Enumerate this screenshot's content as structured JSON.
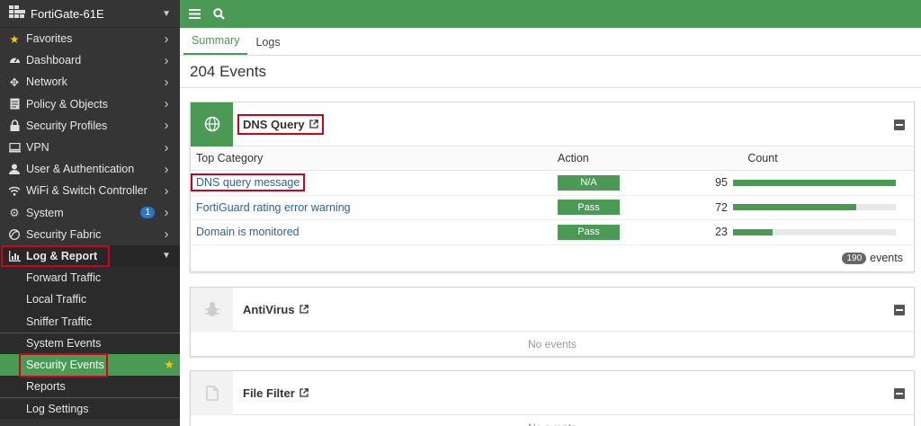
{
  "sidebar": {
    "device": "FortiGate-61E",
    "items": [
      {
        "label": "Favorites",
        "icon": "star-icon"
      },
      {
        "label": "Dashboard",
        "icon": "dashboard-icon"
      },
      {
        "label": "Network",
        "icon": "network-icon"
      },
      {
        "label": "Policy & Objects",
        "icon": "policy-icon"
      },
      {
        "label": "Security Profiles",
        "icon": "lock-icon"
      },
      {
        "label": "VPN",
        "icon": "monitor-icon"
      },
      {
        "label": "User & Authentication",
        "icon": "user-icon"
      },
      {
        "label": "WiFi & Switch Controller",
        "icon": "wifi-icon"
      },
      {
        "label": "System",
        "icon": "gear-icon",
        "badge": "1"
      },
      {
        "label": "Security Fabric",
        "icon": "fabric-icon"
      },
      {
        "label": "Log & Report",
        "icon": "chart-icon"
      }
    ],
    "sub_items": [
      {
        "label": "Forward Traffic"
      },
      {
        "label": "Local Traffic"
      },
      {
        "label": "Sniffer Traffic"
      },
      {
        "label": "System Events"
      },
      {
        "label": "Security Events"
      },
      {
        "label": "Reports"
      },
      {
        "label": "Log Settings"
      }
    ]
  },
  "tabs": [
    "Summary",
    "Logs"
  ],
  "events_title": "204 Events",
  "dns_card": {
    "title": "DNS Query",
    "columns": [
      "Top Category",
      "Action",
      "Count"
    ],
    "rows": [
      {
        "category": "DNS query message",
        "action": "N/A",
        "count": "95",
        "fraction": 1.0
      },
      {
        "category": "FortiGuard rating error warning",
        "action": "Pass",
        "count": "72",
        "fraction": 0.758
      },
      {
        "category": "Domain is monitored",
        "action": "Pass",
        "count": "23",
        "fraction": 0.242
      }
    ],
    "footer_count": "190",
    "footer_label": "events"
  },
  "antivirus_card": {
    "title": "AntiVirus",
    "empty": "No events"
  },
  "filefilter_card": {
    "title": "File Filter",
    "empty": "No events"
  },
  "colors": {
    "accent": "#4a9a55",
    "highlight": "#d0021b",
    "sidebar_bg": "#353535"
  }
}
